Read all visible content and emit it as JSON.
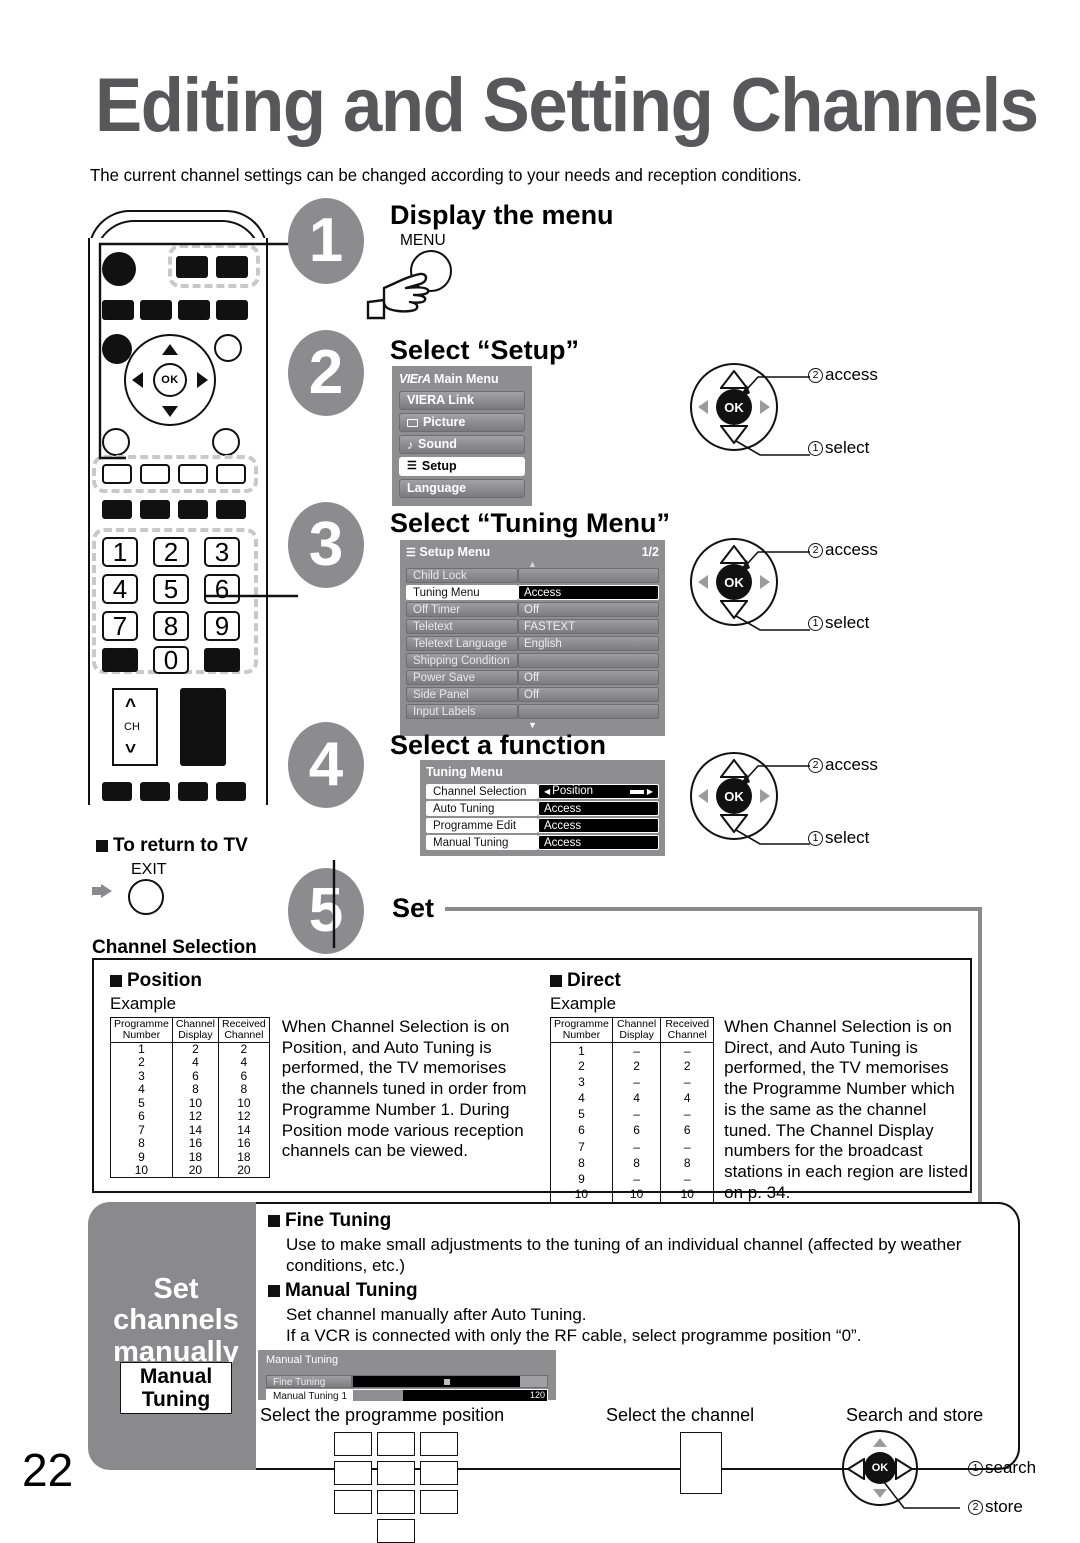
{
  "page": {
    "number": "22",
    "title": "Editing and Setting Channels",
    "intro": "The current channel settings can be changed according to your needs and reception conditions."
  },
  "steps": [
    {
      "num": "1",
      "heading": "Display the menu",
      "button_label": "MENU"
    },
    {
      "num": "2",
      "heading": "Select “Setup”"
    },
    {
      "num": "3",
      "heading": "Select “Tuning Menu”"
    },
    {
      "num": "4",
      "heading": "Select a function"
    },
    {
      "num": "5",
      "heading": "Set"
    }
  ],
  "remote": {
    "keys": [
      "1",
      "2",
      "3",
      "4",
      "5",
      "6",
      "7",
      "8",
      "9",
      "0"
    ],
    "ch_label": "CH",
    "ok_label": "OK",
    "return_heading": "To return to TV",
    "exit_label": "EXIT"
  },
  "viera_menu": {
    "title_logo": "VIErA",
    "title": "Main Menu",
    "items": [
      {
        "label": "VIERA Link",
        "icon": "",
        "selected": false
      },
      {
        "label": "Picture",
        "icon": "picture-icon",
        "selected": false
      },
      {
        "label": "Sound",
        "icon": "note-icon",
        "selected": false
      },
      {
        "label": "Setup",
        "icon": "list-icon",
        "selected": true
      },
      {
        "label": "Language",
        "icon": "",
        "selected": false
      }
    ]
  },
  "setup_menu": {
    "title": "Setup Menu",
    "page_indicator": "1/2",
    "rows": [
      {
        "label": "Child Lock",
        "value": "",
        "selected": false
      },
      {
        "label": "Tuning Menu",
        "value": "Access",
        "selected": true
      },
      {
        "label": "Off Timer",
        "value": "Off",
        "selected": false
      },
      {
        "label": "Teletext",
        "value": "FASTEXT",
        "selected": false
      },
      {
        "label": "Teletext Language",
        "value": "English",
        "selected": false
      },
      {
        "label": "Shipping Condition",
        "value": "",
        "selected": false
      },
      {
        "label": "Power Save",
        "value": "Off",
        "selected": false
      },
      {
        "label": "Side Panel",
        "value": "Off",
        "selected": false
      },
      {
        "label": "Input Labels",
        "value": "",
        "selected": false
      }
    ]
  },
  "tuning_menu": {
    "title": "Tuning Menu",
    "rows": [
      {
        "label": "Channel Selection",
        "value": "Position",
        "selected": true,
        "arrows": true
      },
      {
        "label": "Auto Tuning",
        "value": "Access",
        "selected": false,
        "arrows": false
      },
      {
        "label": "Programme Edit",
        "value": "Access",
        "selected": false,
        "arrows": false
      },
      {
        "label": "Manual Tuning",
        "value": "Access",
        "selected": false,
        "arrows": false
      }
    ]
  },
  "nav_hints": {
    "access": "access",
    "select": "select",
    "num_access": "2",
    "num_select": "1",
    "ok": "OK"
  },
  "channel_selection": {
    "caption": "Channel Selection",
    "position": {
      "heading": "Position",
      "example_label": "Example",
      "columns": [
        "Programme Number",
        "Channel Display",
        "Received Channel"
      ],
      "rows": [
        [
          "1",
          "2",
          "2"
        ],
        [
          "2",
          "4",
          "4"
        ],
        [
          "3",
          "6",
          "6"
        ],
        [
          "4",
          "8",
          "8"
        ],
        [
          "5",
          "10",
          "10"
        ],
        [
          "6",
          "12",
          "12"
        ],
        [
          "7",
          "14",
          "14"
        ],
        [
          "8",
          "16",
          "16"
        ],
        [
          "9",
          "18",
          "18"
        ],
        [
          "10",
          "20",
          "20"
        ]
      ],
      "description": "When Channel Selection is on Position, and Auto Tuning is performed, the TV memorises the channels tuned in order from Programme Number 1. During Position mode various reception channels can be viewed."
    },
    "direct": {
      "heading": "Direct",
      "example_label": "Example",
      "columns": [
        "Programme Number",
        "Channel Display",
        "Received Channel"
      ],
      "rows": [
        [
          "1",
          "–",
          "–"
        ],
        [
          "2",
          "2",
          "2"
        ],
        [
          "3",
          "–",
          "–"
        ],
        [
          "4",
          "4",
          "4"
        ],
        [
          "5",
          "–",
          "–"
        ],
        [
          "6",
          "6",
          "6"
        ],
        [
          "7",
          "–",
          "–"
        ],
        [
          "8",
          "8",
          "8"
        ],
        [
          "9",
          "–",
          "–"
        ],
        [
          "10",
          "10",
          "10"
        ]
      ],
      "description": "When Channel Selection is on Direct, and Auto Tuning is performed, the TV memorises the Programme Number which is the same as the channel tuned. The Channel Display numbers for the broadcast stations in each region are listed on p. 34."
    }
  },
  "manual_section": {
    "side_title": "Set channels manually",
    "side_badge": "Manual Tuning",
    "fine_tuning": {
      "heading": "Fine Tuning",
      "text": "Use to make small adjustments to the tuning of an individual channel (affected by weather conditions, etc.)"
    },
    "manual_tuning": {
      "heading": "Manual Tuning",
      "text_line1": "Set channel manually after Auto Tuning.",
      "text_line2": "If a VCR is connected with only the RF cable, select programme position “0”."
    },
    "osd": {
      "title": "Manual Tuning",
      "row1_label": "Fine Tuning",
      "row2_label": "Manual Tuning",
      "row2_value": "1",
      "row2_max": "120"
    },
    "hints": {
      "programme_position": "Select the programme position",
      "channel": "Select the channel",
      "search_store": "Search and store",
      "search_num": "1",
      "search_label": "search",
      "store_num": "2",
      "store_label": "store"
    }
  }
}
